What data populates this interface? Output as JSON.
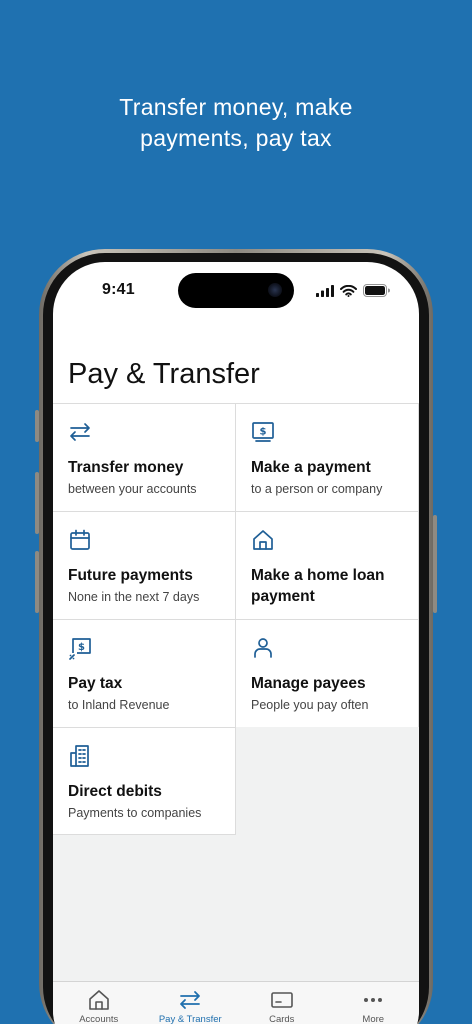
{
  "headline": {
    "line1": "Transfer money, make",
    "line2": "payments, pay tax"
  },
  "status": {
    "time": "9:41"
  },
  "page": {
    "title": "Pay & Transfer"
  },
  "colors": {
    "background": "#1f71b0",
    "accent": "#1f6fae",
    "icon": "#1f5f96",
    "tab_inactive": "#555555",
    "grid_bg": "#f1f2f2"
  },
  "tiles": [
    {
      "title": "Transfer money",
      "subtitle": "between your accounts",
      "icon": "transfer-arrows-icon"
    },
    {
      "title": "Make a payment",
      "subtitle": "to a person or company",
      "icon": "dollar-note-icon"
    },
    {
      "title": "Future payments",
      "subtitle": "None in the next 7 days",
      "icon": "calendar-icon"
    },
    {
      "title": "Make a home loan payment",
      "subtitle": "",
      "icon": "house-icon"
    },
    {
      "title": "Pay tax",
      "subtitle": "to Inland Revenue",
      "icon": "tax-note-icon"
    },
    {
      "title": "Manage payees",
      "subtitle": "People you pay often",
      "icon": "person-icon"
    },
    {
      "title": "Direct debits",
      "subtitle": "Payments to companies",
      "icon": "building-icon"
    }
  ],
  "tabs": [
    {
      "label": "Accounts",
      "icon": "house-icon",
      "active": false
    },
    {
      "label": "Pay & Transfer",
      "icon": "transfer-arrows-icon",
      "active": true
    },
    {
      "label": "Cards",
      "icon": "card-icon",
      "active": false
    },
    {
      "label": "More",
      "icon": "more-dots-icon",
      "active": false
    }
  ]
}
